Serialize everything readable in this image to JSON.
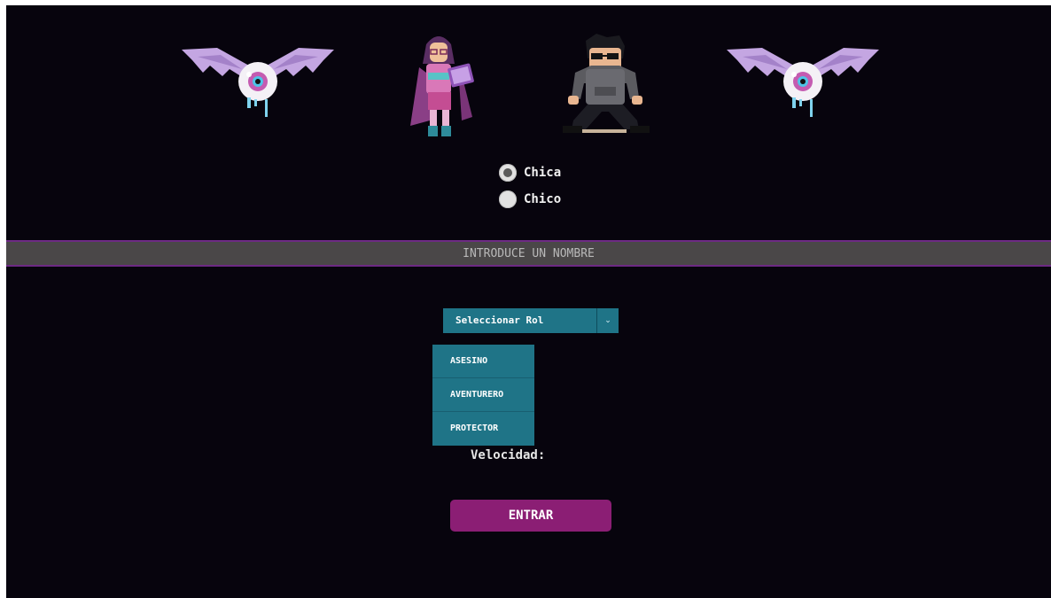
{
  "characters": {
    "left_eye_icon": "winged-eyeball-icon",
    "right_eye_icon": "winged-eyeball-icon",
    "girl_sprite": "girl-mage-sprite",
    "boy_sprite": "boy-hoodie-sprite"
  },
  "gender": {
    "options": [
      {
        "label": "Chica",
        "checked": true
      },
      {
        "label": "Chico",
        "checked": false
      }
    ]
  },
  "name_input": {
    "placeholder": "INTRODUCE UN NOMBRE",
    "value": ""
  },
  "role": {
    "selected_label": "Seleccionar Rol",
    "options": [
      "ASESINO",
      "AVENTURERO",
      "PROTECTOR"
    ]
  },
  "stats": {
    "speed_label": "Velocidad:"
  },
  "enter_button_label": "ENTRAR",
  "colors": {
    "background": "#07040d",
    "input_bar": "#4a4748",
    "input_border": "#6d2a84",
    "select_bg": "#1f7487",
    "button_bg": "#8b1e74",
    "text": "#f2f2f2"
  }
}
